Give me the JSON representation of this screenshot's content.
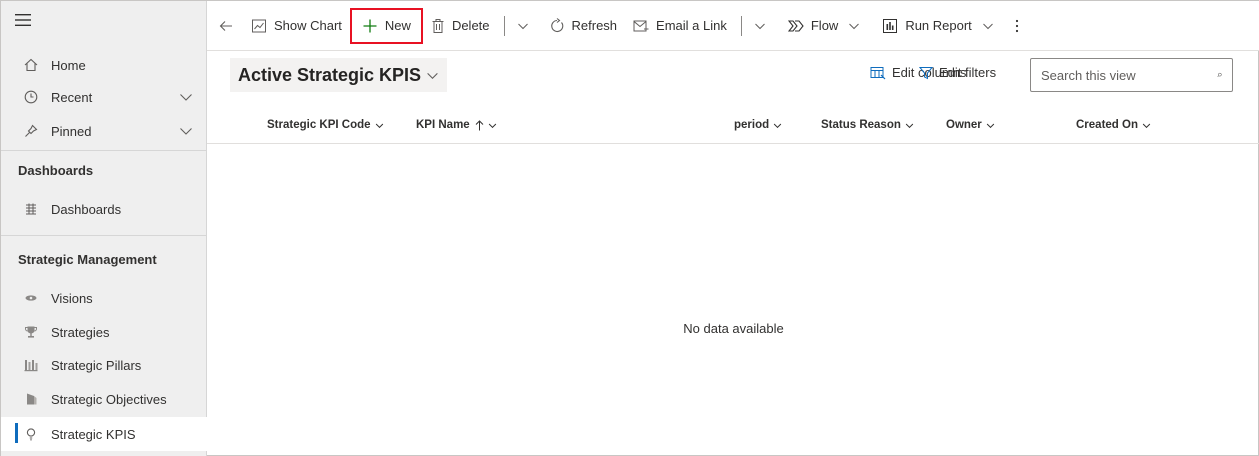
{
  "sidebar": {
    "nav": [
      {
        "label": "Home",
        "icon": "home-icon"
      },
      {
        "label": "Recent",
        "icon": "clock-icon"
      },
      {
        "label": "Pinned",
        "icon": "pin-icon"
      }
    ],
    "dashboards_header": "Dashboards",
    "dashboards_item": "Dashboards",
    "section_header": "Strategic Management",
    "items": [
      {
        "label": "Visions",
        "icon": "eye-icon"
      },
      {
        "label": "Strategies",
        "icon": "trophy-icon"
      },
      {
        "label": "Strategic Pillars",
        "icon": "pillars-icon"
      },
      {
        "label": "Strategic Objectives",
        "icon": "objectives-icon"
      },
      {
        "label": "Strategic KPIS",
        "icon": "lightbulb-icon"
      }
    ]
  },
  "toolbar": {
    "show_chart": "Show Chart",
    "new": "New",
    "delete": "Delete",
    "refresh": "Refresh",
    "email_link": "Email a Link",
    "flow": "Flow",
    "run_report": "Run Report"
  },
  "view": {
    "title": "Active Strategic KPIS",
    "edit_columns": "Edit columns",
    "edit_filters": "Edit filters",
    "search_placeholder": "Search this view"
  },
  "grid": {
    "columns": {
      "code": "Strategic KPI Code",
      "name": "KPI Name",
      "period": "period",
      "status": "Status Reason",
      "owner": "Owner",
      "created": "Created On"
    },
    "empty_message": "No data available"
  },
  "colors": {
    "accent": "#0f6cbd",
    "highlight": "#e81123",
    "sidebar_bg": "#efefef"
  }
}
